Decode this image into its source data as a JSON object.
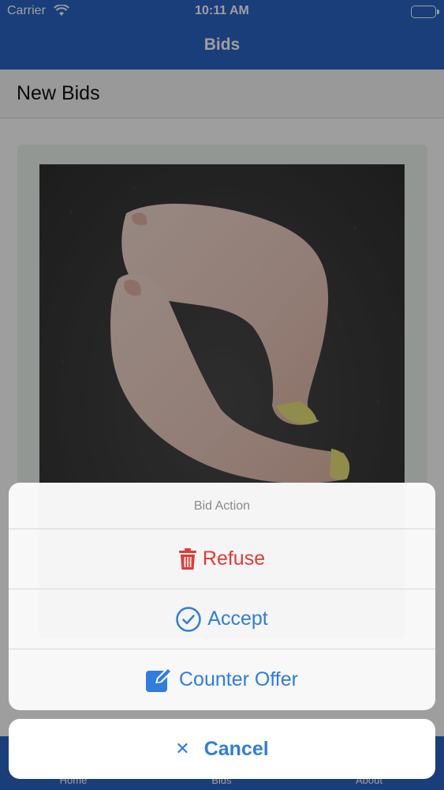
{
  "status_bar": {
    "carrier": "Carrier",
    "time": "10:11 AM"
  },
  "nav": {
    "title": "Bids"
  },
  "section": {
    "title": "New Bids"
  },
  "tabs": [
    {
      "label": "Home"
    },
    {
      "label": "Bids"
    },
    {
      "label": "About"
    }
  ],
  "action_sheet": {
    "title": "Bid Action",
    "actions": [
      {
        "label": "Refuse",
        "icon": "trash-icon",
        "color": "#e53935"
      },
      {
        "label": "Accept",
        "icon": "checkmark-circle-icon",
        "color": "#2f7de1"
      },
      {
        "label": "Counter Offer",
        "icon": "edit-icon",
        "color": "#2f7de1"
      }
    ],
    "cancel": {
      "label": "Cancel",
      "icon": "close-icon"
    }
  },
  "colors": {
    "brand": "#2a64c6",
    "accent": "#2f7de1",
    "danger": "#e53935"
  }
}
